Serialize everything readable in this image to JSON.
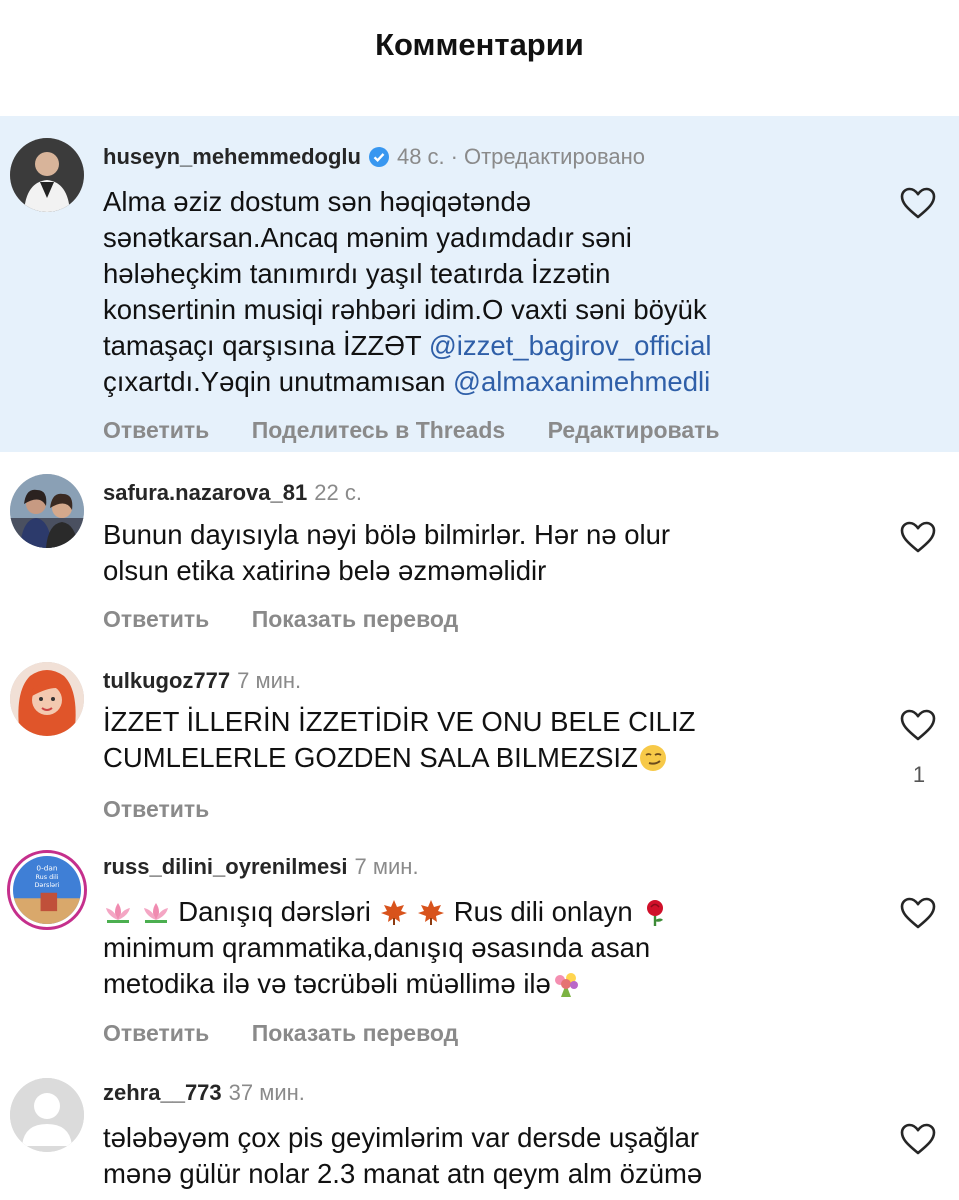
{
  "header": {
    "title": "Комментарии"
  },
  "comments": [
    {
      "username": "huseyn_mehemmedoglu",
      "verified": true,
      "time": "48 с.",
      "edited": "Отредактировано",
      "lines": [
        "Alma əziz dostum sən həqiqətəndə",
        "sənətkarsan.Ancaq mənim yadımdadır səni",
        "hələheçkim tanımırdı yaşıl teatırda İzzətin",
        "konsertinin musiqi rəhbəri idim.O vaxti səni böyük"
      ],
      "line5_text": "tamaşaçı qarşısına İZZƏT ",
      "line5_mention": "@izzet_bagirov_official",
      "line6_text": "çıxartdı.Yəqin unutmamısan ",
      "line6_mention": "@almaxanimehmedli",
      "actions": [
        "Ответить",
        "Поделитесь в Threads",
        "Редактировать"
      ]
    },
    {
      "username": "safura.nazarova_81",
      "time": "22 с.",
      "lines": [
        "Bunun dayısıyla nəyi bölə bilmirlər. Hər nə olur",
        "olsun etika xatirinə belə əzməməlidir"
      ],
      "actions": [
        "Ответить",
        "Показать перевод"
      ]
    },
    {
      "username": "tulkugoz777",
      "time": "7 мин.",
      "lines": [
        "İZZET İLLERİN İZZETİDİR VE ONU BELE CILIZ",
        "CUMLELERLE GOZDEN SALA BILMEZSIZ"
      ],
      "like_count": "1",
      "actions": [
        "Ответить"
      ]
    },
    {
      "username": "russ_dilini_oyrenilmesi",
      "time": "7 мин.",
      "line1_a": " Danışıq dərsləri",
      "line1_b": " Rus dili onlayn",
      "lines": [
        "minimum qrammatika,danışıq əsasında asan",
        "metodika ilə və təcrübəli müəllimə ilə"
      ],
      "avatar_text": [
        "0-dan",
        "Rus dili",
        "Dərsləri"
      ],
      "actions": [
        "Ответить",
        "Показать перевод"
      ]
    },
    {
      "username": "zehra__773",
      "time": "37 мин.",
      "lines": [
        "tələbəyəm çox pis geyimlərim var dersde uşağlar",
        "mənə gülür nolar 2.3 manat atn qeym alm özümə"
      ]
    }
  ]
}
